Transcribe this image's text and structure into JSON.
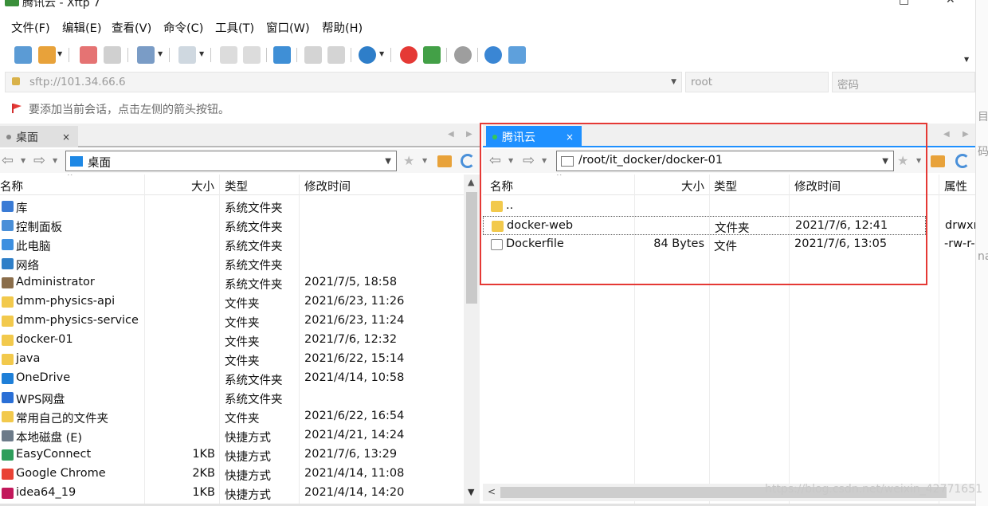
{
  "window": {
    "title": "腾讯云 - Xftp 7",
    "maximize_glyph": "□",
    "close_glyph": "✕"
  },
  "menu": [
    "文件(F)",
    "编辑(E)",
    "查看(V)",
    "命令(C)",
    "工具(T)",
    "窗口(W)",
    "帮助(H)"
  ],
  "toolbar": {
    "icons": [
      "new-session-icon",
      "open-folder-icon",
      "disconnect-icon",
      "link-icon",
      "properties-icon",
      "terminal-icon",
      "upload-icon",
      "download-icon",
      "transfer-icon",
      "copy-icon",
      "paste-icon",
      "globe-icon",
      "xshell-icon",
      "xftp-icon",
      "settings-icon",
      "help-icon",
      "chat-icon"
    ]
  },
  "connection": {
    "address": "sftp://101.34.66.6",
    "user_placeholder": "root",
    "password_placeholder": "密码"
  },
  "hint": "要添加当前会话，点击左侧的箭头按钮。",
  "left_pane": {
    "tab": "桌面",
    "tab_close": "×",
    "path": "桌面",
    "columns": [
      "名称",
      "大小",
      "类型",
      "修改时间"
    ],
    "rows": [
      {
        "name": "库",
        "size": "",
        "type": "系统文件夹",
        "modified": "",
        "icon": "#3a7bd5"
      },
      {
        "name": "控制面板",
        "size": "",
        "type": "系统文件夹",
        "modified": "",
        "icon": "#4a8fd8"
      },
      {
        "name": "此电脑",
        "size": "",
        "type": "系统文件夹",
        "modified": "",
        "icon": "#3d8fe0"
      },
      {
        "name": "网络",
        "size": "",
        "type": "系统文件夹",
        "modified": "",
        "icon": "#2f7fc8"
      },
      {
        "name": "Administrator",
        "size": "",
        "type": "系统文件夹",
        "modified": "2021/7/5, 18:58",
        "icon": "#8a6d4a"
      },
      {
        "name": "dmm-physics-api",
        "size": "",
        "type": "文件夹",
        "modified": "2021/6/23, 11:26",
        "icon": "#f2c94c"
      },
      {
        "name": "dmm-physics-service",
        "size": "",
        "type": "文件夹",
        "modified": "2021/6/23, 11:24",
        "icon": "#f2c94c"
      },
      {
        "name": "docker-01",
        "size": "",
        "type": "文件夹",
        "modified": "2021/7/6, 12:32",
        "icon": "#f2c94c"
      },
      {
        "name": "java",
        "size": "",
        "type": "文件夹",
        "modified": "2021/6/22, 15:14",
        "icon": "#f2c94c"
      },
      {
        "name": "OneDrive",
        "size": "",
        "type": "系统文件夹",
        "modified": "2021/4/14, 10:58",
        "icon": "#1e7fd8"
      },
      {
        "name": "WPS网盘",
        "size": "",
        "type": "系统文件夹",
        "modified": "",
        "icon": "#2a6fd6"
      },
      {
        "name": "常用自己的文件夹",
        "size": "",
        "type": "文件夹",
        "modified": "2021/6/22, 16:54",
        "icon": "#f2c94c"
      },
      {
        "name": "本地磁盘 (E)",
        "size": "",
        "type": "快捷方式",
        "modified": "2021/4/21, 14:24",
        "icon": "#6c7a89"
      },
      {
        "name": "EasyConnect",
        "size": "1KB",
        "type": "快捷方式",
        "modified": "2021/7/6, 13:29",
        "icon": "#2e9e5b"
      },
      {
        "name": "Google Chrome",
        "size": "2KB",
        "type": "快捷方式",
        "modified": "2021/4/14, 11:08",
        "icon": "#e94235"
      },
      {
        "name": "idea64_19",
        "size": "1KB",
        "type": "快捷方式",
        "modified": "2021/4/14, 14:20",
        "icon": "#c2185b"
      }
    ]
  },
  "right_pane": {
    "tab": "腾讯云",
    "tab_close": "×",
    "path": "/root/it_docker/docker-01",
    "columns": [
      "名称",
      "大小",
      "类型",
      "修改时间",
      "属性"
    ],
    "rows": [
      {
        "name": "..",
        "size": "",
        "type": "",
        "modified": "",
        "attrs": "",
        "icon": "#f2c94c"
      },
      {
        "name": "docker-web",
        "size": "",
        "type": "文件夹",
        "modified": "2021/7/6, 12:41",
        "attrs": "drwxr",
        "icon": "#f2c94c"
      },
      {
        "name": "Dockerfile",
        "size": "84 Bytes",
        "type": "文件",
        "modified": "2021/7/6, 13:05",
        "attrs": "-rw-r-",
        "icon": "#ffffff"
      }
    ]
  },
  "side_fragments": [
    "目",
    "码",
    "nar"
  ],
  "watermark": "https://blog.csdn.net/weixin_42771651"
}
